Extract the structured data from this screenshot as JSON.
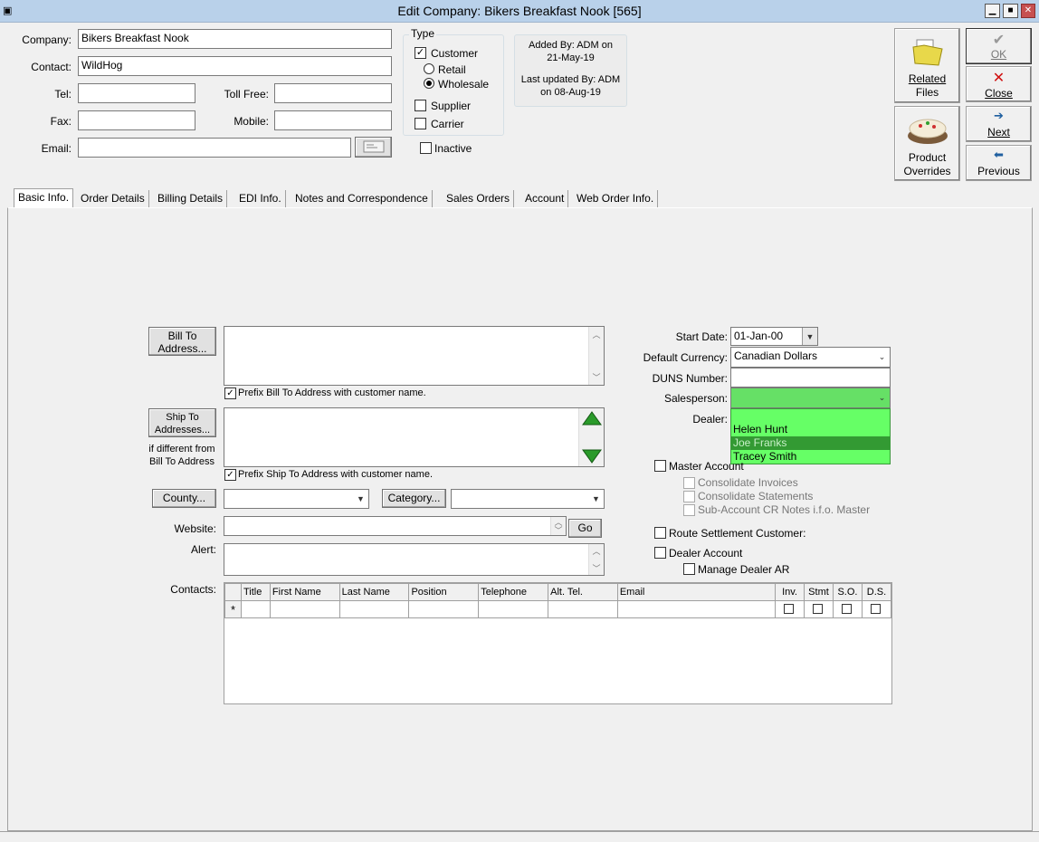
{
  "window": {
    "title": "Edit Company: Bikers Breakfast Nook [565]"
  },
  "header": {
    "company_label": "Company:",
    "company_value": "Bikers Breakfast Nook",
    "contact_label": "Contact:",
    "contact_value": "WildHog",
    "tel_label": "Tel:",
    "tel_value": "",
    "tollfree_label": "Toll Free:",
    "tollfree_value": "",
    "fax_label": "Fax:",
    "fax_value": "",
    "mobile_label": "Mobile:",
    "mobile_value": "",
    "email_label": "Email:",
    "email_value": ""
  },
  "type": {
    "group_label": "Type",
    "customer_label": "Customer",
    "customer_checked": true,
    "retail_label": "Retail",
    "wholesale_label": "Wholesale",
    "selected_radio": "Wholesale",
    "supplier_label": "Supplier",
    "carrier_label": "Carrier",
    "inactive_label": "Inactive"
  },
  "audit": {
    "added_by": "Added By: ADM on",
    "added_date": "21-May-19",
    "updated_by": "Last updated By: ADM",
    "updated_date": "on 08-Aug-19"
  },
  "actions": {
    "related_files_line1": "Related",
    "related_files_line2": "Files",
    "product_overrides_line1": "Product",
    "product_overrides_line2": "Overrides",
    "ok_label": "OK",
    "close_label": "Close",
    "next_label": "Next",
    "previous_label": "Previous"
  },
  "tabs": [
    {
      "label": "Basic Info."
    },
    {
      "label": "Order Details"
    },
    {
      "label": "Billing Details"
    },
    {
      "label": "EDI Info."
    },
    {
      "label": "Notes and Correspondence"
    },
    {
      "label": "Sales Orders"
    },
    {
      "label": "Account"
    },
    {
      "label": "Web Order Info."
    }
  ],
  "basic": {
    "bill_to_btn_line1": "Bill To",
    "bill_to_btn_line2": "Address...",
    "prefix_bill": "Prefix Bill To Address with customer name.",
    "ship_to_btn_line1": "Ship To",
    "ship_to_btn_line2": "Addresses...",
    "if_different_line1": "if different from",
    "if_different_line2": "Bill To Address",
    "prefix_ship": "Prefix Ship To Address with customer name.",
    "county_btn": "County...",
    "category_btn": "Category...",
    "website_label": "Website:",
    "go_btn": "Go",
    "alert_label": "Alert:",
    "contacts_label": "Contacts:",
    "start_date_label": "Start Date:",
    "start_date_value": "01-Jan-00",
    "currency_label": "Default Currency:",
    "currency_value": "Canadian Dollars",
    "duns_label": "DUNS Number:",
    "salesperson_label": "Salesperson:",
    "dealer_label": "Dealer:",
    "dropdown_options": [
      "",
      "Helen Hunt",
      "Joe Franks",
      "Tracey Smith"
    ],
    "dropdown_highlighted": "Joe Franks",
    "master_account": "Master Account",
    "consolidate_invoices": "Consolidate Invoices",
    "consolidate_statements": "Consolidate Statements",
    "subaccount_cr": "Sub-Account CR Notes i.f.o. Master",
    "route_settlement": "Route Settlement Customer:",
    "dealer_account": "Dealer Account",
    "manage_dealer_ar": "Manage Dealer AR"
  },
  "contacts_grid": {
    "columns": [
      "Title",
      "First Name",
      "Last Name",
      "Position",
      "Telephone",
      "Alt. Tel.",
      "Email",
      "Inv.",
      "Stmt",
      "S.O.",
      "D.S."
    ],
    "new_row_marker": "*"
  }
}
